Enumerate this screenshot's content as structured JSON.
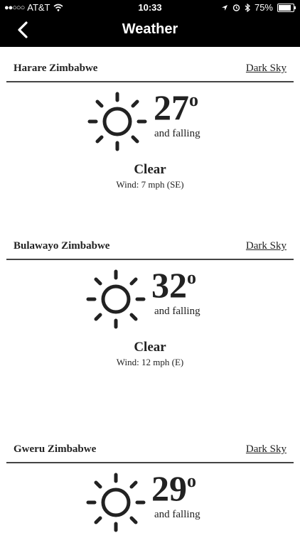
{
  "status": {
    "carrier": "AT&T",
    "time": "10:33",
    "battery": "75%",
    "signal_dots": "●●○○○"
  },
  "nav": {
    "title": "Weather"
  },
  "locations": [
    {
      "name": "Harare Zimbabwe",
      "source": "Dark Sky",
      "temp": "27",
      "degree": "o",
      "trend": "and falling",
      "condition": "Clear",
      "wind": "Wind: 7 mph (SE)"
    },
    {
      "name": "Bulawayo Zimbabwe",
      "source": "Dark Sky",
      "temp": "32",
      "degree": "o",
      "trend": "and falling",
      "condition": "Clear",
      "wind": "Wind: 12 mph (E)"
    },
    {
      "name": "Gweru Zimbabwe",
      "source": "Dark Sky",
      "temp": "29",
      "degree": "o",
      "trend": "and falling"
    }
  ]
}
